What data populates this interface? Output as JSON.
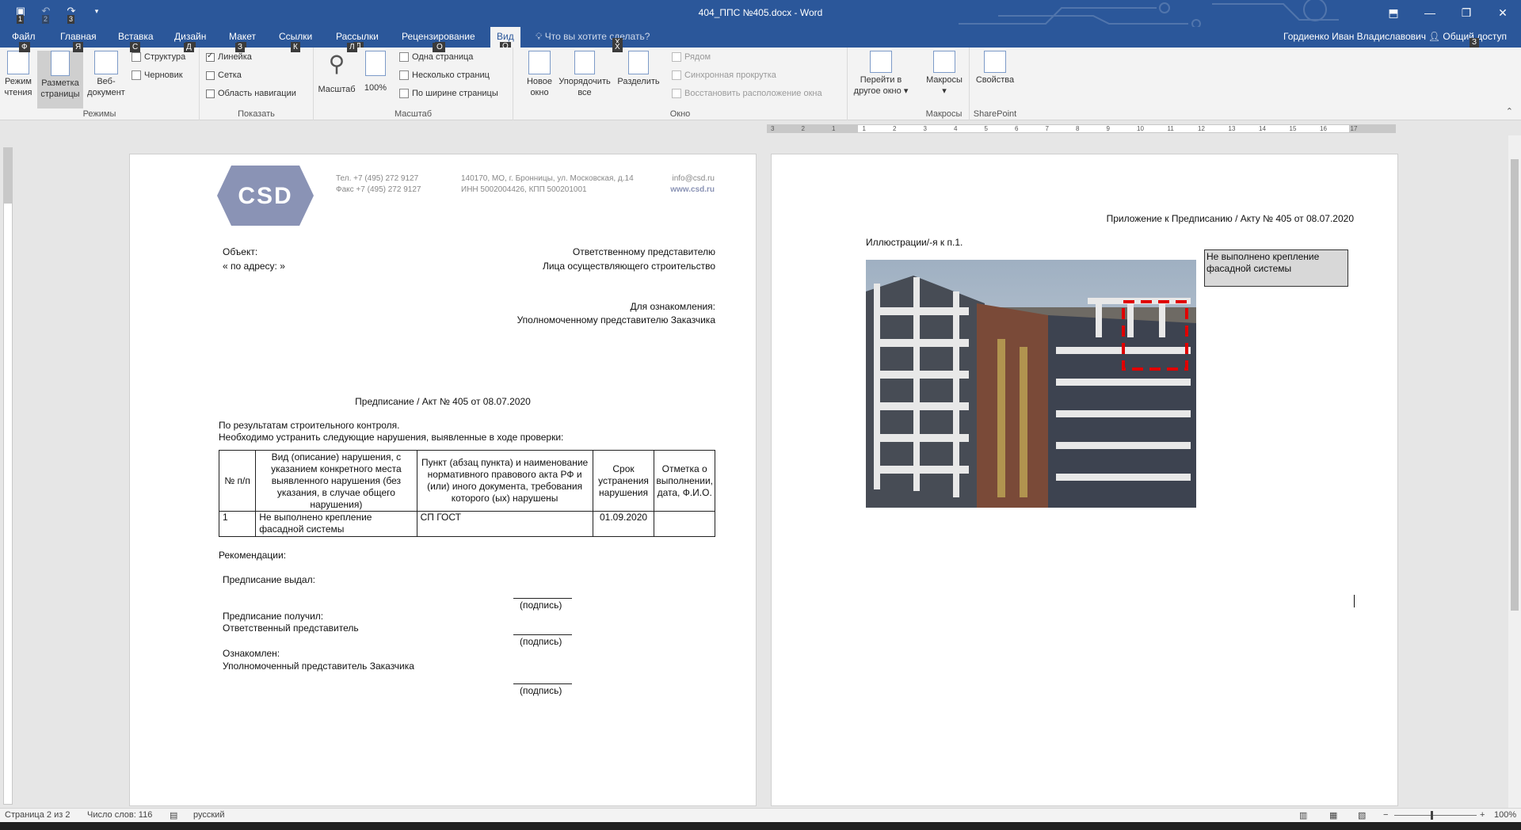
{
  "titlebar": {
    "title": "404_ППС №405.docx - Word",
    "qat_keys": [
      "1",
      "2",
      "3"
    ],
    "minimize": "—",
    "restore": "❐",
    "close": "✕",
    "ribbon_display": "⬒"
  },
  "tabs": [
    {
      "label": "Файл",
      "key": "Ф"
    },
    {
      "label": "Главная",
      "key": "Я"
    },
    {
      "label": "Вставка",
      "key": "С"
    },
    {
      "label": "Дизайн",
      "key": "Д"
    },
    {
      "label": "Макет",
      "key": "З"
    },
    {
      "label": "Ссылки",
      "key": "К"
    },
    {
      "label": "Рассылки",
      "key": "Л"
    },
    {
      "label": "Рецензирование",
      "key": "И"
    },
    {
      "label": "Вид",
      "key": "О"
    }
  ],
  "tell_me": {
    "text": "Что вы хотите сделать?",
    "key": "Х"
  },
  "user_name": "Гордиенко Иван Владиславович",
  "share": {
    "label": "Общий доступ",
    "key": "З"
  },
  "ribbon": {
    "modes": {
      "label": "Режимы",
      "read_mode": [
        "Режим",
        "чтения"
      ],
      "print_layout": [
        "Разметка",
        "страницы"
      ],
      "web_layout": [
        "Веб-",
        "документ"
      ],
      "outline": "Структура",
      "draft": "Черновик"
    },
    "show": {
      "label": "Показать",
      "ruler": "Линейка",
      "gridlines": "Сетка",
      "nav_pane": "Область навигации",
      "ruler_checked": true,
      "gridlines_checked": false,
      "nav_pane_checked": false
    },
    "zoom": {
      "label": "Масштаб",
      "zoom": "Масштаб",
      "hundred": "100%",
      "one_page": "Одна страница",
      "multiple_pages": "Несколько страниц",
      "page_width": "По ширине страницы"
    },
    "window": {
      "label": "Окно",
      "new_window": [
        "Новое",
        "окно"
      ],
      "arrange_all": [
        "Упорядочить",
        "все"
      ],
      "split": "Разделить",
      "side_by_side": "Рядом",
      "sync_scroll": "Синхронная прокрутка",
      "reset_position": "Восстановить расположение окна",
      "switch_windows": [
        "Перейти в",
        "другое окно"
      ]
    },
    "macros": {
      "label": "Макросы",
      "macros": "Макросы"
    },
    "sharepoint": {
      "label": "SharePoint",
      "properties": "Свойства"
    },
    "key_tips": {
      "read": "Ф",
      "print": "Я",
      "web": "С",
      "outline": "Д",
      "draft": "З",
      "ruler": "К",
      "zoom": "Л",
      "hundred": "И",
      "one_page": "О",
      "multi": "Х"
    }
  },
  "page1": {
    "letterhead": {
      "phone": "Тел. +7 (495) 272 9127",
      "fax": "Факс +7 (495) 272 9127",
      "address": "140170, МО, г. Бронницы, ул. Московская, д.14",
      "inn": "ИНН 5002004426, КПП 500201001",
      "email": "info@csd.ru",
      "web": "www.csd.ru",
      "logo_text": "CSD"
    },
    "object_label": "Объект:",
    "address_line": "«  по адресу: »",
    "to_line1": "Ответственному представителю",
    "to_line2": "Лица осуществляющего строительство",
    "review_label": "Для ознакомления:",
    "review_to": "Уполномоченному представителю Заказчика",
    "title": "Предписание / Акт № 405 от 08.07.2020",
    "intro1": "По результатам строительного контроля.",
    "intro2": "Необходимо устранить следующие нарушения, выявленные в ходе проверки:",
    "table": {
      "headers": [
        "№ п/п",
        "Вид (описание) нарушения, с указанием конкретного места выявленного нарушения (без указания, в случае общего нарушения)",
        "Пункт (абзац пункта) и наименование нормативного правового акта РФ и (или) иного документа, требования которого (ых) нарушены",
        "Срок устранения нарушения",
        "Отметка о выполнении, дата, Ф.И.О."
      ],
      "rows": [
        [
          "1",
          "Не выполнено крепление фасадной системы",
          "СП ГОСТ",
          "01.09.2020",
          ""
        ]
      ]
    },
    "recommendations": "Рекомендации:",
    "issued": "Предписание выдал:",
    "signature": "(подпись)",
    "received": "Предписание получил:",
    "responsible": "Ответственный представитель",
    "acquainted": "Ознакомлен:",
    "customer_rep": "Уполномоченный представитель Заказчика"
  },
  "page2": {
    "appendix_title": "Приложение к Предписанию / Акту № 405 от 08.07.2020",
    "illustrations": "Иллюстрации/-я к п.1.",
    "callout": "Не выполнено крепление фасадной системы"
  },
  "ruler_numbers": [
    "3",
    "2",
    "1",
    "1",
    "2",
    "3",
    "4",
    "5",
    "6",
    "7",
    "8",
    "9",
    "10",
    "11",
    "12",
    "13",
    "14",
    "15",
    "16",
    "17"
  ],
  "status": {
    "page": "Страница 2 из 2",
    "words": "Число слов: 116",
    "language": "русский",
    "zoom": "100%"
  }
}
